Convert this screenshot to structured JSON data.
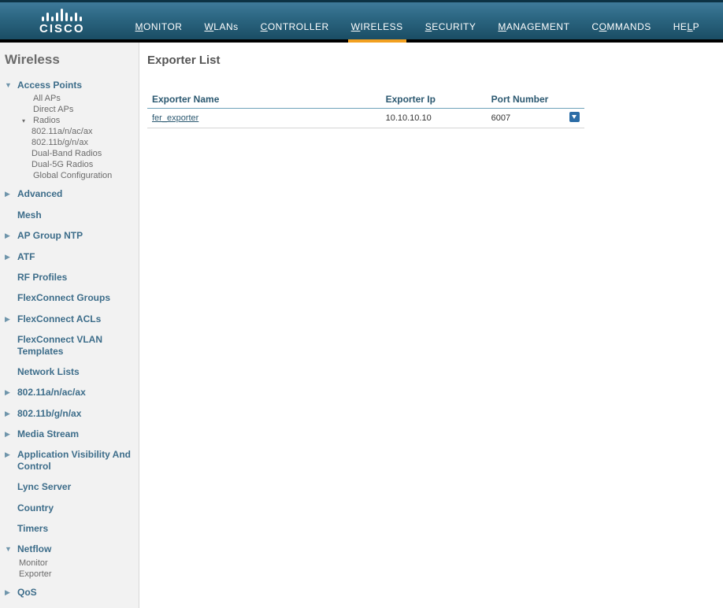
{
  "brand": {
    "name": "CISCO"
  },
  "nav": {
    "items": [
      {
        "pre": "M",
        "rest": "ONITOR"
      },
      {
        "pre": "W",
        "rest": "LANs"
      },
      {
        "pre": "C",
        "rest": "ONTROLLER"
      },
      {
        "pre": "W",
        "rest": "IRELESS"
      },
      {
        "pre": "S",
        "rest": "ECURITY"
      },
      {
        "pre": "M",
        "rest": "ANAGEMENT"
      },
      {
        "pre": "C",
        "rest": "OMMANDS",
        "ul2": "O",
        "rest2": "MMANDS"
      },
      {
        "pre": "HE",
        "rest": "LP",
        "ul2": "L",
        "rest2": "P"
      }
    ],
    "selected_index": 3
  },
  "sidebar": {
    "title": "Wireless",
    "access_points": {
      "label": "Access Points",
      "children": [
        "All APs",
        "Direct APs"
      ],
      "radios": {
        "label": "Radios",
        "children": [
          "802.11a/n/ac/ax",
          "802.11b/g/n/ax",
          "Dual-Band Radios",
          "Dual-5G Radios"
        ]
      },
      "global_config": "Global Configuration"
    },
    "items": [
      {
        "label": "Advanced",
        "arrow": "▶"
      },
      {
        "label": "Mesh",
        "arrow": ""
      },
      {
        "label": "AP Group NTP",
        "arrow": "▶"
      },
      {
        "label": "ATF",
        "arrow": "▶"
      },
      {
        "label": "RF Profiles",
        "arrow": ""
      },
      {
        "label": "FlexConnect Groups",
        "arrow": ""
      },
      {
        "label": "FlexConnect ACLs",
        "arrow": "▶"
      },
      {
        "label": "FlexConnect VLAN Templates",
        "arrow": ""
      },
      {
        "label": "Network Lists",
        "arrow": ""
      },
      {
        "label": "802.11a/n/ac/ax",
        "arrow": "▶"
      },
      {
        "label": "802.11b/g/n/ax",
        "arrow": "▶"
      },
      {
        "label": "Media Stream",
        "arrow": "▶"
      },
      {
        "label": "Application Visibility And Control",
        "arrow": "▶"
      },
      {
        "label": "Lync Server",
        "arrow": ""
      },
      {
        "label": "Country",
        "arrow": ""
      },
      {
        "label": "Timers",
        "arrow": ""
      }
    ],
    "netflow": {
      "label": "Netflow",
      "children": [
        "Monitor",
        "Exporter"
      ]
    },
    "qos": {
      "label": "QoS"
    }
  },
  "content": {
    "title": "Exporter List",
    "columns": [
      "Exporter Name",
      "Exporter Ip",
      "Port Number"
    ],
    "rows": [
      {
        "name": "fer_exporter",
        "ip": "10.10.10.10",
        "port": "6007"
      }
    ]
  }
}
